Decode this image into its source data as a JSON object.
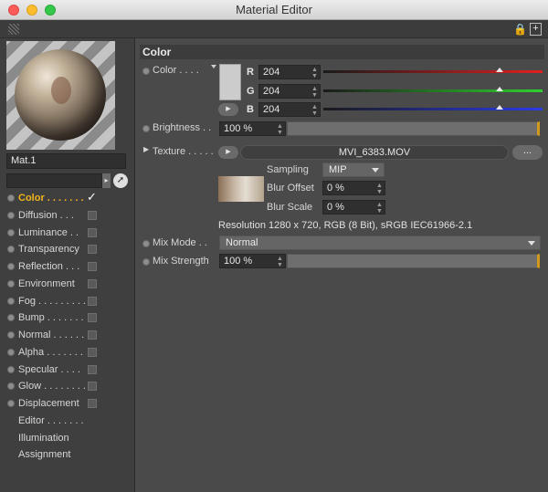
{
  "window": {
    "title": "Material Editor"
  },
  "material": {
    "name": "Mat.1"
  },
  "channels": [
    {
      "label": "Color",
      "dots": ". . . . . . .",
      "enabled": true,
      "active": true
    },
    {
      "label": "Diffusion",
      "dots": ". . .",
      "enabled": false
    },
    {
      "label": "Luminance",
      "dots": ". .",
      "enabled": false
    },
    {
      "label": "Transparency",
      "dots": "",
      "enabled": false
    },
    {
      "label": "Reflection",
      "dots": ". . .",
      "enabled": false
    },
    {
      "label": "Environment",
      "dots": "",
      "enabled": false
    },
    {
      "label": "Fog",
      "dots": ". . . . . . . . .",
      "enabled": false
    },
    {
      "label": "Bump",
      "dots": ". . . . . . .",
      "enabled": false
    },
    {
      "label": "Normal",
      "dots": ". . . . . .",
      "enabled": false
    },
    {
      "label": "Alpha",
      "dots": ". . . . . . .",
      "enabled": false
    },
    {
      "label": "Specular",
      "dots": ". . . .",
      "enabled": false
    },
    {
      "label": "Glow",
      "dots": ". . . . . . . .",
      "enabled": false
    },
    {
      "label": "Displacement",
      "dots": "",
      "enabled": false
    }
  ],
  "extra_items": [
    {
      "label": "Editor",
      "dots": ". . . . . . ."
    },
    {
      "label": "Illumination",
      "dots": ""
    },
    {
      "label": "Assignment",
      "dots": ""
    }
  ],
  "color_section": {
    "header": "Color",
    "color_label": "Color",
    "color_dots": ". . . .",
    "swatch_color": "#cccccc",
    "r_label": "R",
    "r_value": "204",
    "r_fraction": 0.8,
    "g_label": "G",
    "g_value": "204",
    "g_fraction": 0.8,
    "b_label": "B",
    "b_value": "204",
    "b_fraction": 0.8,
    "brightness_label": "Brightness",
    "brightness_dots": ". .",
    "brightness_value": "100 %",
    "brightness_fraction": 1.0,
    "texture_label": "Texture",
    "texture_dots": ". . . . .",
    "texture_file": "MVI_6383.MOV",
    "more_button": "...",
    "sampling_label": "Sampling",
    "sampling_value": "MIP",
    "blur_offset_label": "Blur Offset",
    "blur_offset_value": "0 %",
    "blur_scale_label": "Blur Scale",
    "blur_scale_value": "0 %",
    "resolution_text": "Resolution 1280 x 720, RGB (8 Bit), sRGB IEC61966-2.1",
    "mix_mode_label": "Mix Mode",
    "mix_mode_dots": ". .",
    "mix_mode_value": "Normal",
    "mix_strength_label": "Mix Strength",
    "mix_strength_value": "100 %",
    "mix_strength_fraction": 1.0
  },
  "colors": {
    "accent": "#f2b51d",
    "red": "#e02020",
    "green": "#2fd02f",
    "blue": "#2a3ae8"
  }
}
